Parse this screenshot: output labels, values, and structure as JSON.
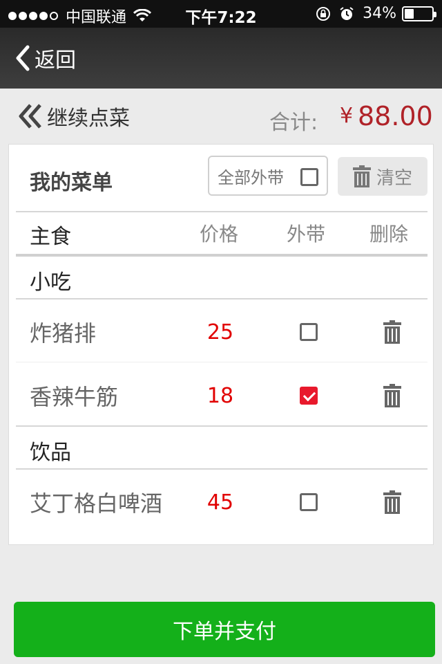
{
  "status_bar": {
    "carrier": "中国联通",
    "time": "下午7:22",
    "battery_percent": "34%",
    "battery_level": 0.34
  },
  "nav": {
    "back_label": "返回"
  },
  "subheader": {
    "continue_label": "继续点菜",
    "total_label": "合计:",
    "currency": "¥",
    "total_amount": "88.00"
  },
  "menu": {
    "title": "我的菜单",
    "takeaway_all_label": "全部外带",
    "takeaway_all_checked": false,
    "clear_label": "清空",
    "columns": {
      "main": "主食",
      "price": "价格",
      "takeaway": "外带",
      "delete": "删除"
    },
    "categories": [
      {
        "name": "小吃",
        "items": [
          {
            "name": "炸猪排",
            "price": "25",
            "takeaway": false
          },
          {
            "name": "香辣牛筋",
            "price": "18",
            "takeaway": true
          }
        ]
      },
      {
        "name": "饮品",
        "items": [
          {
            "name": "艾丁格白啤酒",
            "price": "45",
            "takeaway": false
          }
        ]
      }
    ]
  },
  "pay_button_label": "下单并支付",
  "colors": {
    "accent_red": "#b02228",
    "price_red": "#e10000",
    "check_red": "#e8192c",
    "pay_green": "#14b01a"
  },
  "icons": {
    "back": "chevron-left-icon",
    "continue": "double-chevron-left-icon",
    "clear": "trash-icon",
    "delete": "trash-icon"
  }
}
